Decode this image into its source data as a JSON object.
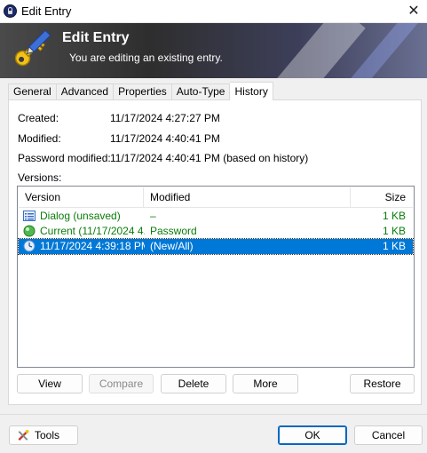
{
  "window": {
    "title": "Edit Entry",
    "close_glyph": "✕"
  },
  "banner": {
    "title": "Edit Entry",
    "subtitle": "You are editing an existing entry."
  },
  "tabs": [
    {
      "label": "General",
      "active": false
    },
    {
      "label": "Advanced",
      "active": false
    },
    {
      "label": "Properties",
      "active": false
    },
    {
      "label": "Auto-Type",
      "active": false
    },
    {
      "label": "History",
      "active": true
    }
  ],
  "history": {
    "created_label": "Created:",
    "created_value": "11/17/2024 4:27:27 PM",
    "modified_label": "Modified:",
    "modified_value": "11/17/2024 4:40:41 PM",
    "password_modified_label": "Password modified:",
    "password_modified_value": "11/17/2024 4:40:41 PM (based on history)",
    "versions_label": "Versions:",
    "columns": [
      "Version",
      "Modified",
      "Size"
    ],
    "rows": [
      {
        "version": "Dialog (unsaved)",
        "modified": "–",
        "size": "1 KB",
        "icon": "dialog-list-icon",
        "style": "green"
      },
      {
        "version": "Current (11/17/2024 4...",
        "modified": "Password",
        "size": "1 KB",
        "icon": "green-circle-icon",
        "style": "green"
      },
      {
        "version": "11/17/2024 4:39:18 PM",
        "modified": "(New/All)",
        "size": "1 KB",
        "icon": "clock-icon",
        "style": "selected"
      }
    ],
    "buttons": {
      "view": "View",
      "compare": "Compare",
      "delete": "Delete",
      "more": "More",
      "restore": "Restore"
    }
  },
  "footer": {
    "tools": "Tools",
    "ok": "OK",
    "cancel": "Cancel"
  },
  "colors": {
    "selection": "#0078d7",
    "green_text": "#0a7d0a",
    "default_button_border": "#0067c0"
  }
}
